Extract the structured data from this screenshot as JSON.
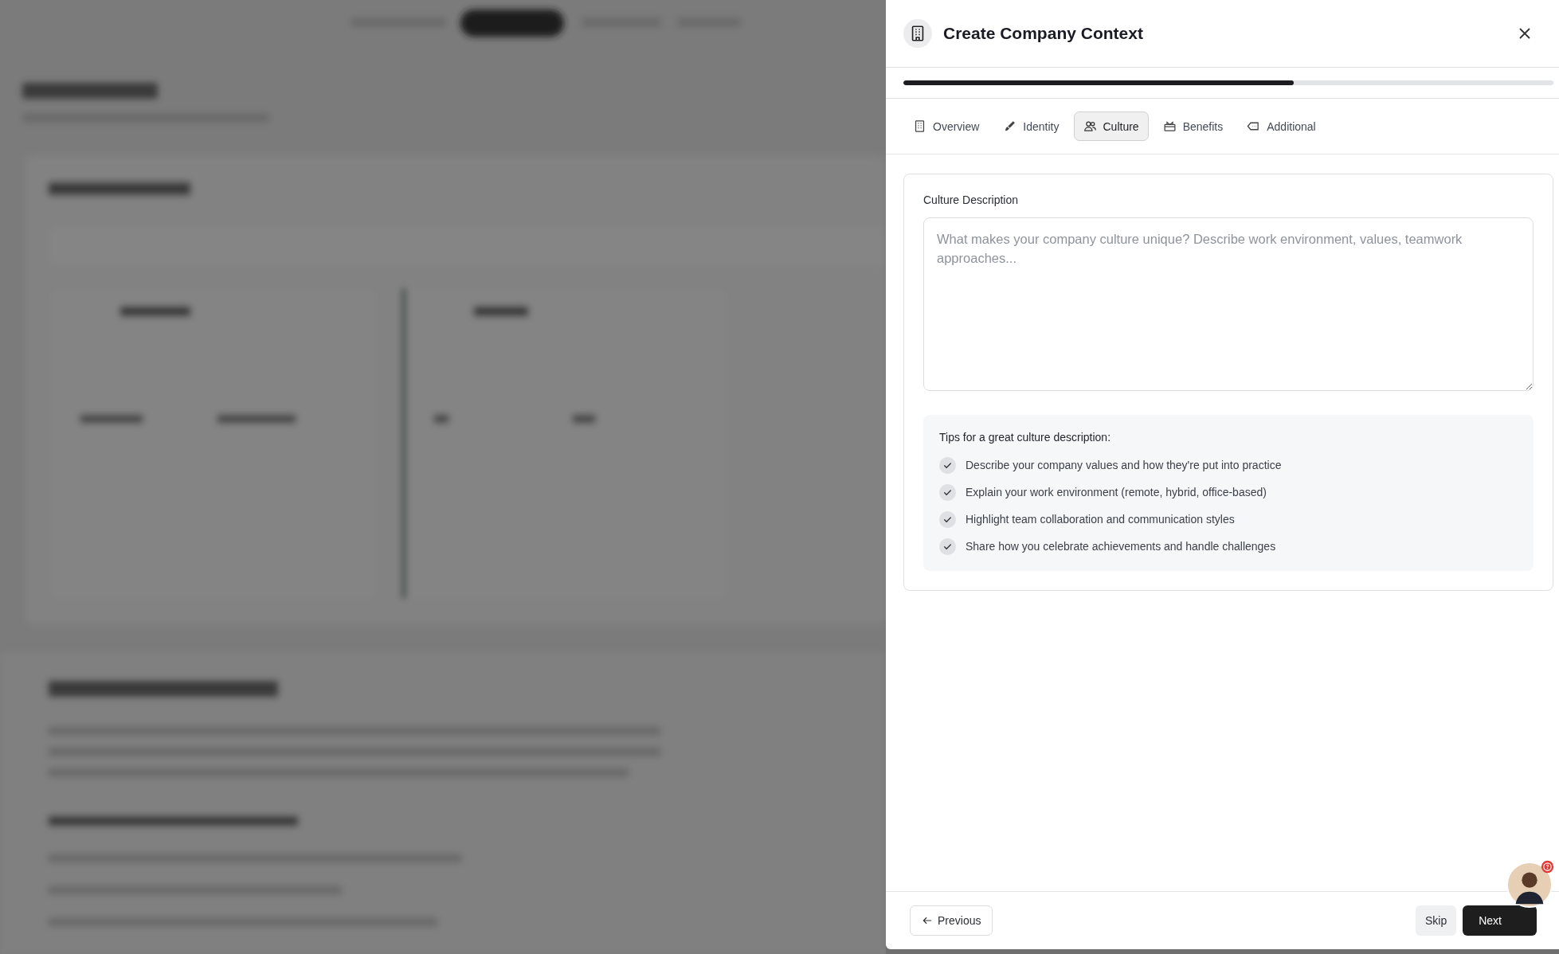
{
  "dialog": {
    "title": "Create Company Context",
    "progress": {
      "level": 0.6
    },
    "tabs": [
      {
        "label": "Overview",
        "selected": false
      },
      {
        "label": "Identity",
        "selected": false
      },
      {
        "label": "Culture",
        "selected": true
      },
      {
        "label": "Benefits",
        "selected": false
      },
      {
        "label": "Additional",
        "selected": false
      }
    ],
    "field": {
      "label": "Culture Description",
      "placeholder": "What makes your company culture unique? Describe work environment, values, teamwork approaches..."
    },
    "tips": {
      "title": "Tips for a great culture description:",
      "items": [
        "Describe your company values and how they're put into practice",
        "Explain your work environment (remote, hybrid, office-based)",
        "Highlight team collaboration and communication styles",
        "Share how you celebrate achievements and handle challenges"
      ]
    },
    "footer": {
      "previous": "Previous",
      "skip": "Skip",
      "next": "Next"
    }
  }
}
